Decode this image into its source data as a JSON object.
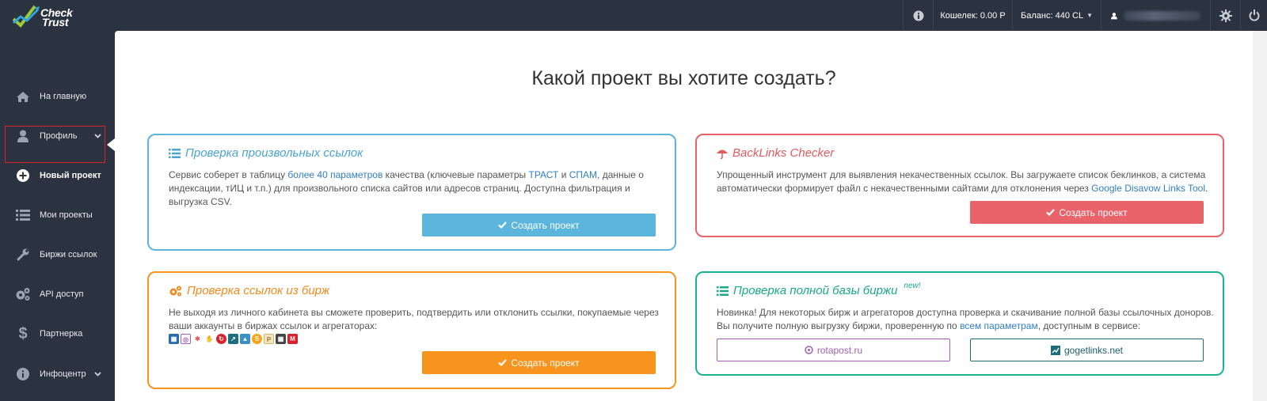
{
  "logo": {
    "line1": "Check",
    "line2": "Trust"
  },
  "topbar": {
    "info_icon": "info-icon",
    "wallet_label": "Кошелек: 0.00 Р",
    "balance_label": "Баланс: 440 CL",
    "user_icon": "user-icon",
    "settings_icon": "gear-icon",
    "power_icon": "power-icon"
  },
  "sidebar": {
    "items": [
      {
        "label": "На главную",
        "icon": "home-icon"
      },
      {
        "label": "Профиль",
        "icon": "user-icon",
        "has_chevron": true
      },
      {
        "label": "Новый проект",
        "icon": "plus-circle-icon",
        "active": true
      },
      {
        "label": "Мои проекты",
        "icon": "list-icon"
      },
      {
        "label": "Биржи ссылок",
        "icon": "wrench-icon"
      },
      {
        "label": "API доступ",
        "icon": "cogs-icon"
      },
      {
        "label": "Партнерка",
        "icon": "dollar-icon"
      },
      {
        "label": "Инфоцентр",
        "icon": "info-circle-icon",
        "has_chevron": true
      }
    ]
  },
  "main": {
    "title": "Какой проект вы хотите создать?",
    "cards": [
      {
        "title": "Проверка произвольных ссылок",
        "desc_parts": [
          "Сервис соберет в таблицу ",
          "более 40 параметров",
          " качества (ключевые параметры ",
          "ТРАСТ",
          " и ",
          "СПАМ",
          ", данные о",
          "индексации, тИЦ и т.п.) для произвольного списка сайтов или адресов страниц. Доступна фильтрация и",
          "выгрузка CSV."
        ],
        "button": "Создать проект",
        "color": "#5bb5dc"
      },
      {
        "title": "BackLinks Checker",
        "desc_line1": "Упрощенный инструмент для выявления некачественных ссылок. Вы загружаете список беклинков, а система",
        "desc_line2_a": "автоматически формирует файл с некачественными сайтами для отклонения через ",
        "desc_line2_link": "Google Disavow Links Tool",
        "desc_line2_b": ".",
        "button": "Создать проект",
        "color": "#e8646a"
      },
      {
        "title": "Проверка ссылок из бирж",
        "desc_line1": "Не выходя из личного кабинета вы сможете проверить, подтвердить или отклонить ссылки, покупаемые через",
        "desc_line2": "ваши аккаунты в биржах ссылок и агрегаторах:",
        "button": "Создать проект",
        "color": "#f7941d"
      },
      {
        "title": "Проверка полной базы биржи",
        "badge": "new!",
        "desc_line1": "Новинка! Для некоторых бирж и агрегаторов доступна проверка и скачивание полной базы ссылочных доноров.",
        "desc_line2_a": "Вы получите полную выгрузку биржи, проверенную по ",
        "desc_line2_link": "всем параметрам",
        "desc_line2_b": ", доступным в сервисе:",
        "btn_left": "rotapost.ru",
        "btn_right": "gogetlinks.net",
        "color": "#1ab394"
      }
    ]
  },
  "colors": {
    "sidebar_bg": "#2b3340",
    "blue": "#5bb5dc",
    "red": "#e8646a",
    "orange": "#f7941d",
    "teal": "#1ab394",
    "purple": "#a35fb5",
    "dark_teal": "#1c6e7d"
  }
}
